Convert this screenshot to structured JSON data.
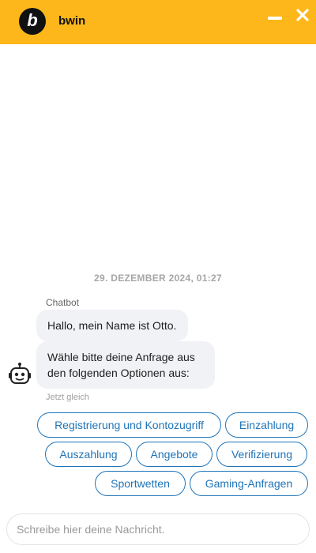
{
  "header": {
    "logo_letter": "b",
    "brand": "bwin",
    "background_color": "#fdb71a",
    "minimize_icon": "minimize-icon",
    "close_icon": "close-icon"
  },
  "chat": {
    "timestamp": "29. DEZEMBER 2024, 01:27",
    "sender": "Chatbot",
    "messages": [
      "Hallo, mein Name ist Otto.",
      "Wähle bitte deine Anfrage aus den folgenden Optionen aus:"
    ],
    "time_hint": "Jetzt gleich",
    "avatar_icon": "robot-icon"
  },
  "options": [
    "Registrierung und Kontozugriff",
    "Einzahlung",
    "Auszahlung",
    "Angebote",
    "Verifizierung",
    "Sportwetten",
    "Gaming-Anfragen"
  ],
  "composer": {
    "placeholder": "Schreibe hier deine Nachricht."
  },
  "colors": {
    "accent": "#1f74b8",
    "header": "#fdb71a",
    "bubble": "#f0f2f5"
  }
}
